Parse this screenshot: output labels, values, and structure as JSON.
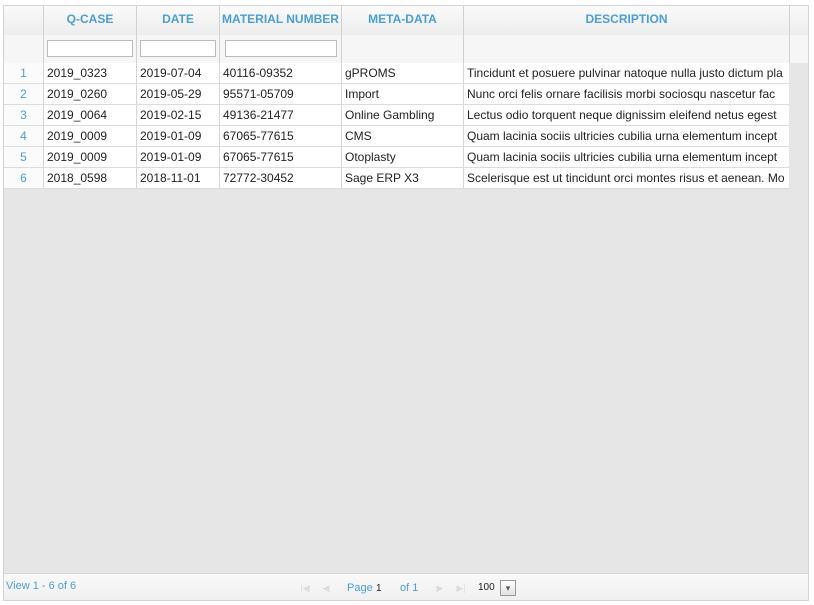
{
  "columns": [
    "Q-CASE",
    "DATE",
    "MATERIAL NUMBER",
    "META-DATA",
    "DESCRIPTION"
  ],
  "filters": [
    "",
    "",
    ""
  ],
  "rows": [
    {
      "n": "1",
      "qcase": "2019_0323",
      "date": "2019-07-04",
      "material": "40116-09352",
      "meta": "gPROMS",
      "desc": "Tincidunt et posuere pulvinar natoque nulla justo dictum pla"
    },
    {
      "n": "2",
      "qcase": "2019_0260",
      "date": "2019-05-29",
      "material": "95571-05709",
      "meta": "Import",
      "desc": "Nunc orci felis ornare facilisis morbi sociosqu nascetur fac"
    },
    {
      "n": "3",
      "qcase": "2019_0064",
      "date": "2019-02-15",
      "material": "49136-21477",
      "meta": "Online Gambling",
      "desc": "Lectus odio torquent neque dignissim eleifend netus egest"
    },
    {
      "n": "4",
      "qcase": "2019_0009",
      "date": "2019-01-09",
      "material": "67065-77615",
      "meta": "CMS",
      "desc": "Quam lacinia sociis ultricies cubilia urna elementum incept"
    },
    {
      "n": "5",
      "qcase": "2019_0009",
      "date": "2019-01-09",
      "material": "67065-77615",
      "meta": "Otoplasty",
      "desc": "Quam lacinia sociis ultricies cubilia urna elementum incept"
    },
    {
      "n": "6",
      "qcase": "2018_0598",
      "date": "2018-11-01",
      "material": "72772-30452",
      "meta": "Sage ERP X3",
      "desc": "Scelerisque est ut tincidunt orci montes risus et aenean. Mo"
    }
  ],
  "pager": {
    "view_info": "View 1 - 6 of 6",
    "page_label": "Page",
    "page_value": "1",
    "of_label": "of 1",
    "rows_per_page": "100"
  }
}
